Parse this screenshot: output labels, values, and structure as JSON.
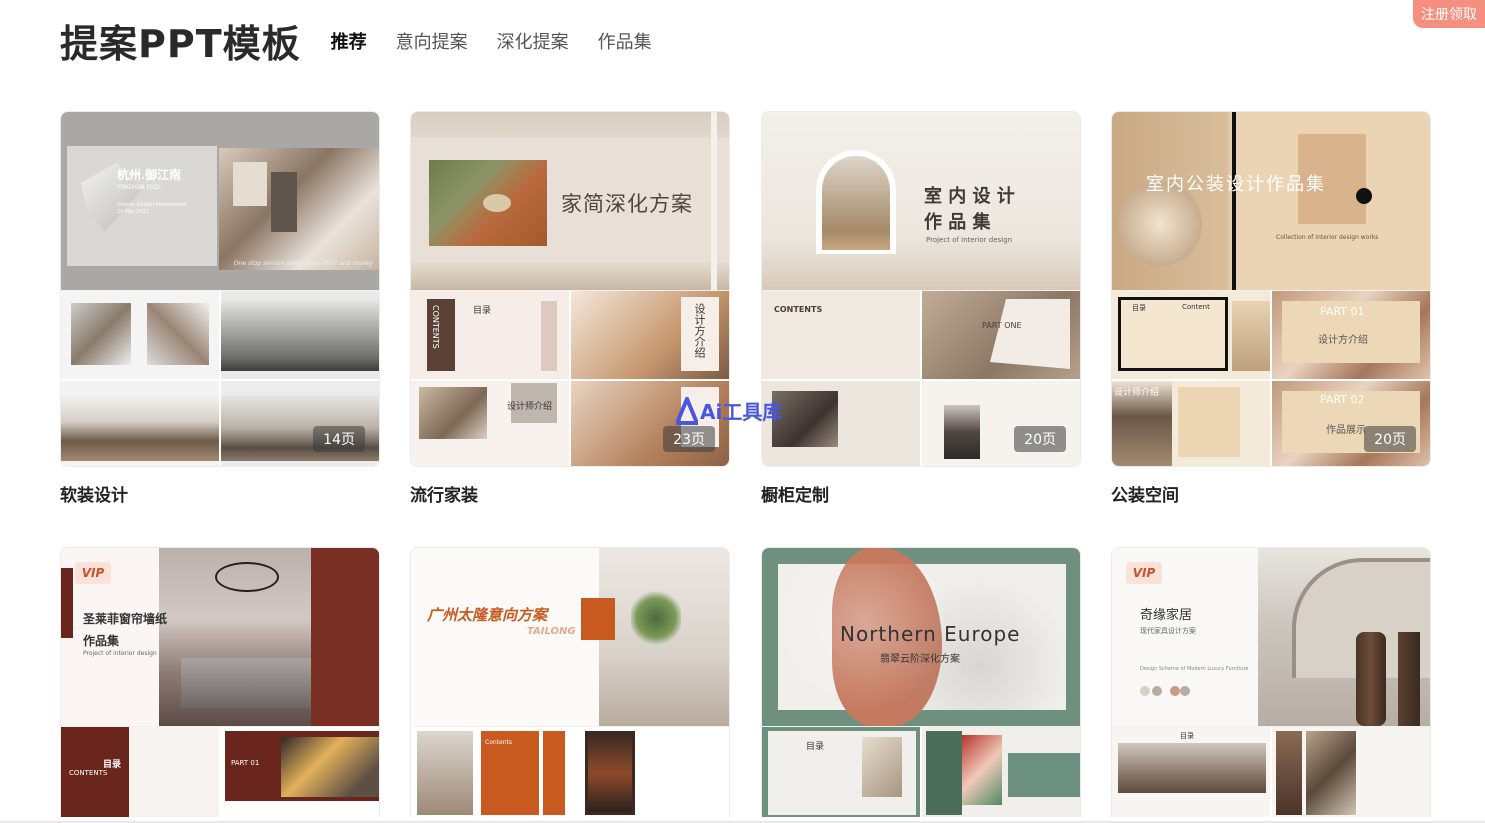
{
  "header": {
    "title": "提案PPT模板",
    "tabs": [
      {
        "label": "推荐",
        "active": true
      },
      {
        "label": "意向提案",
        "active": false
      },
      {
        "label": "深化提案",
        "active": false
      },
      {
        "label": "作品集",
        "active": false
      }
    ]
  },
  "register_button": "注册领取",
  "cards": [
    {
      "label": "软装设计",
      "pages": "14页",
      "cover_title": "杭州.御江南",
      "cover_sub": "YINGHUA FUDI",
      "cover_sub2": "Interior Design Presentation",
      "cover_date": "25 Mar 2021",
      "cover_slogan": "One stop service saves time effort and money"
    },
    {
      "label": "流行家装",
      "pages": "23页",
      "cover_title": "家简深化方案",
      "slide_contents": "CONTENTS",
      "slide_toc": "目录",
      "slide_designer": "设计师介绍",
      "slide_vertical": "设计方介绍"
    },
    {
      "label": "橱柜定制",
      "pages": "20页",
      "cover_title_1": "室 内 设 计",
      "cover_title_2": "作 品 集",
      "cover_sub": "Project of interior design",
      "slide_contents": "CONTENTS",
      "slide_part": "PART ONE"
    },
    {
      "label": "公装空间",
      "pages": "20页",
      "cover_title": "室内公装设计作品集",
      "cover_sub": "Collection of interior design works",
      "slide_toc": "目录",
      "slide_content": "Content",
      "slide_part1": "PART 01",
      "slide_part2": "PART 02",
      "slide_designer": "设计师介绍",
      "slide_show": "作品展示",
      "slide_method": "设计方介绍"
    },
    {
      "vip": "VIP",
      "cover_title": "圣莱菲窗帘墙纸",
      "cover_title_2": "作品集",
      "cover_sub": "Project of interior design",
      "slide_toc": "目录",
      "slide_contents": "CONTENTS",
      "slide_part": "PART 01"
    },
    {
      "cover_title": "广州太隆意向方案",
      "cover_sub": "TAILONG",
      "slide_contents": "Contents"
    },
    {
      "cover_title": "Northern Europe",
      "cover_sub": "翡翠云阶深化方案",
      "slide_toc": "目录"
    },
    {
      "vip": "VIP",
      "cover_title": "奇缘家居",
      "cover_sub": "现代家具设计方案",
      "cover_sub2": "Design Scheme of Modern Luxury Furniture",
      "slide_toc": "目录"
    }
  ],
  "watermark": "Ai工具库",
  "colors": {
    "accent": "#f58f7f",
    "watermark": "#4a56e0",
    "orange": "#c8591f"
  }
}
